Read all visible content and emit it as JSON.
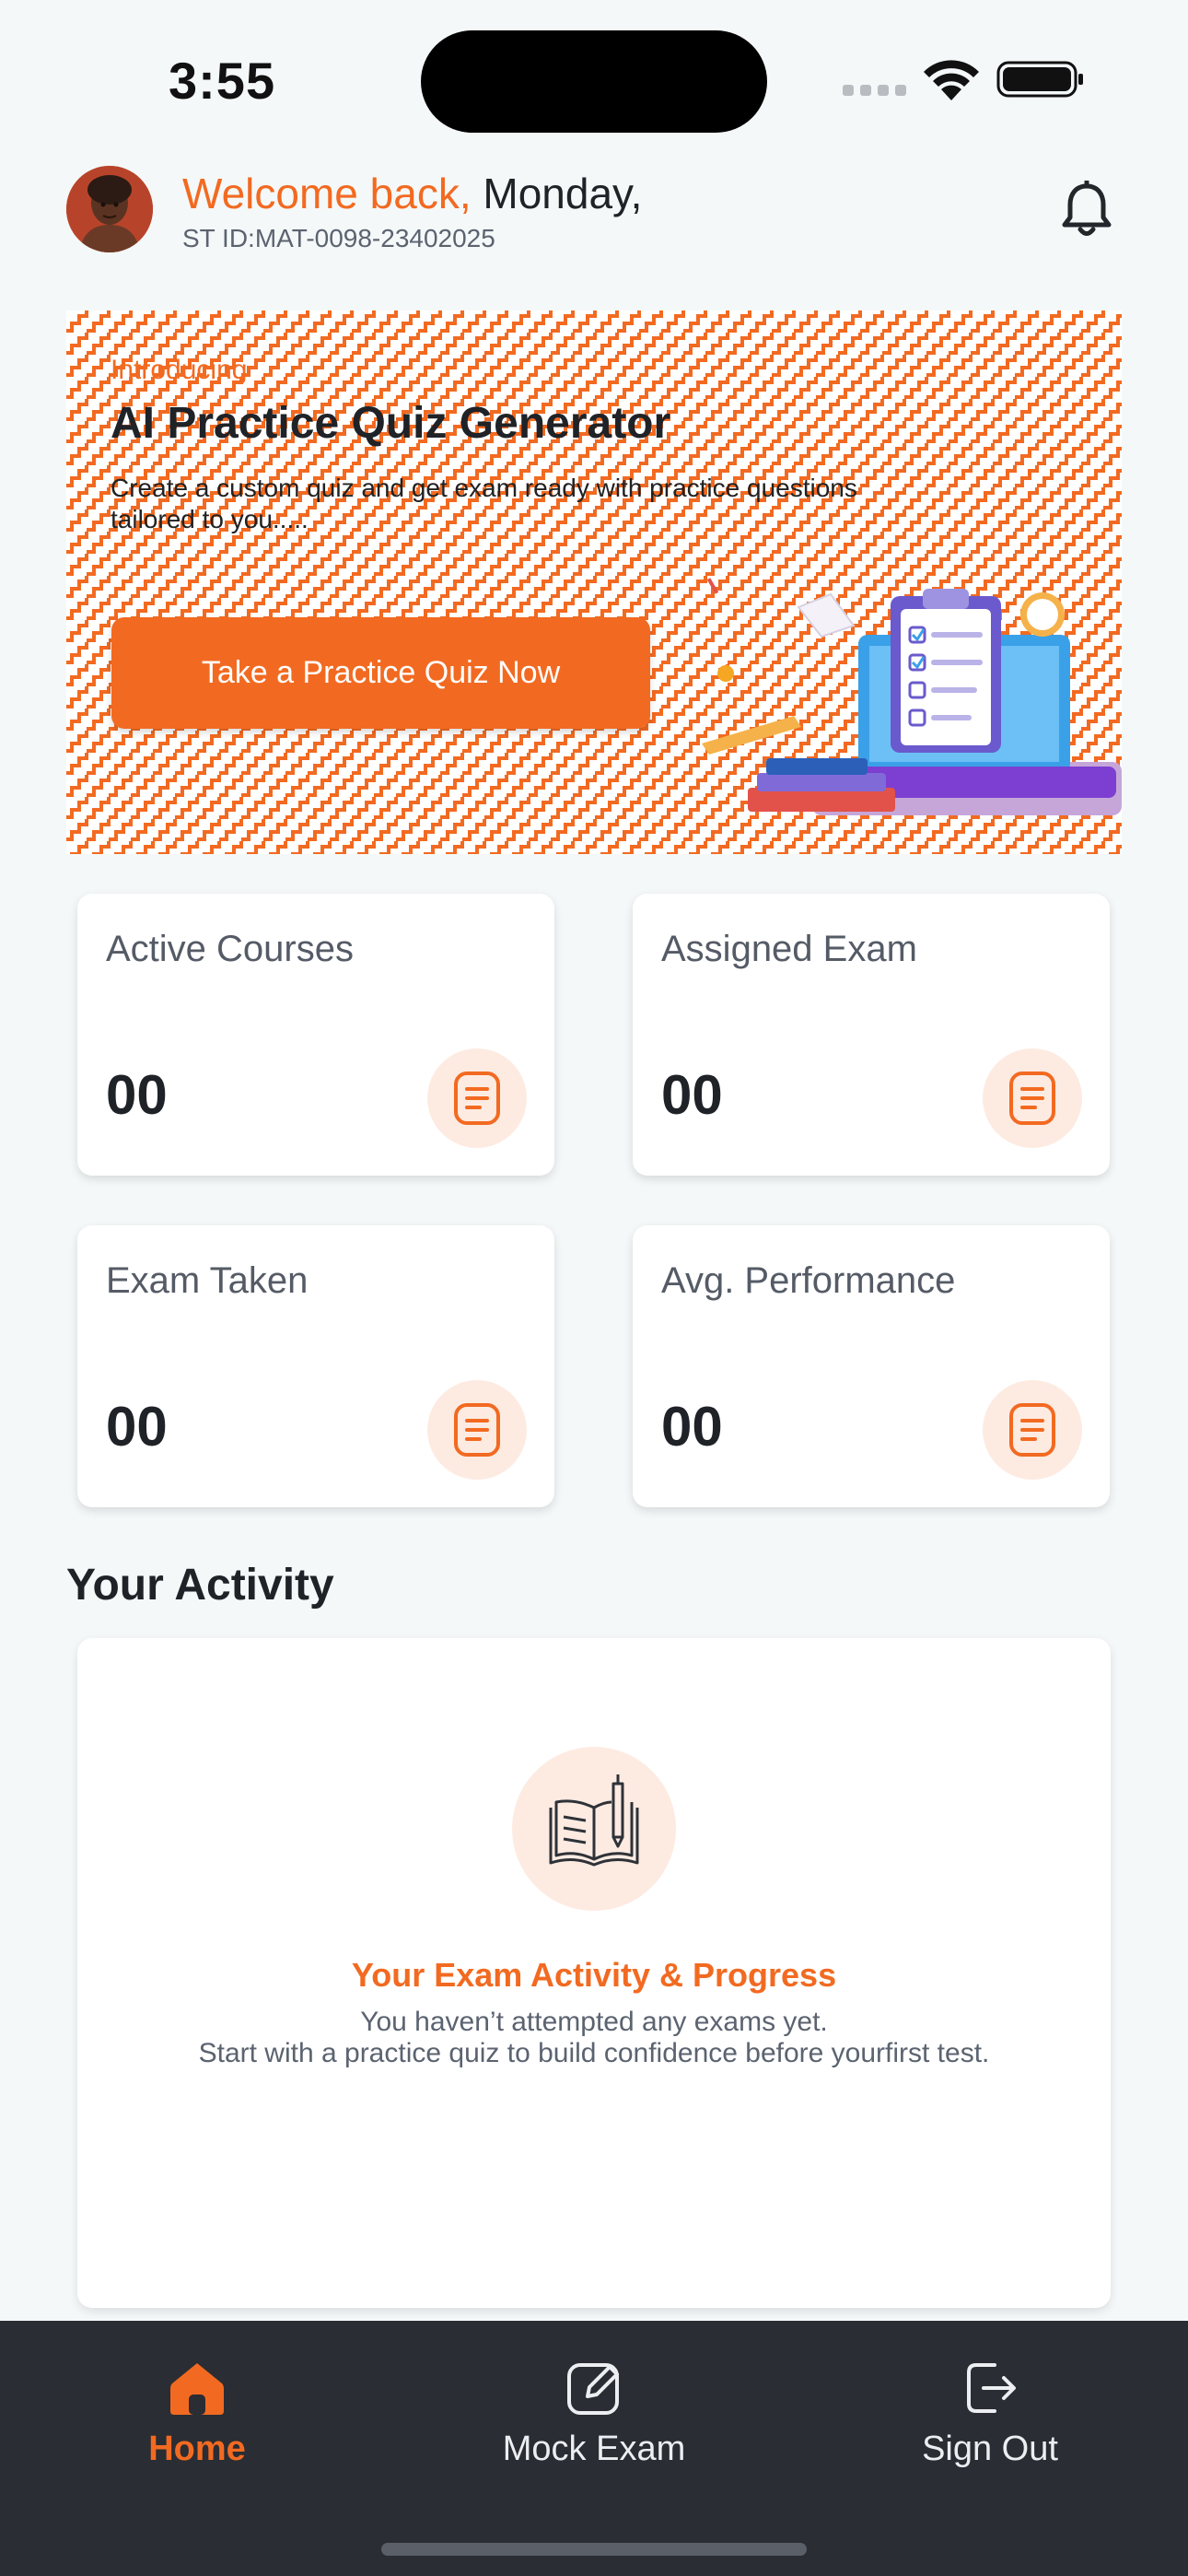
{
  "status_bar": {
    "time": "3:55"
  },
  "header": {
    "greeting": "Welcome back,",
    "day": "Monday,",
    "student_id": "ST ID:MAT-0098-23402025",
    "avatar_icon": "user-avatar",
    "notification_icon": "bell-icon"
  },
  "banner": {
    "intro": "Introducing",
    "title": "AI Practice Quiz Generator",
    "description": "Create a custom quiz and get exam ready with practice questions tailored to you.....",
    "cta_label": "Take a Practice Quiz Now",
    "accent_color": "#f26a21"
  },
  "stats": [
    {
      "title": "Active Courses",
      "value": "00",
      "icon": "document-icon"
    },
    {
      "title": "Assigned Exam",
      "value": "00",
      "icon": "document-icon"
    },
    {
      "title": "Exam Taken",
      "value": "00",
      "icon": "document-icon"
    },
    {
      "title": "Avg. Performance",
      "value": "00",
      "icon": "document-icon"
    }
  ],
  "activity": {
    "section_title": "Your Activity",
    "empty_title": "Your Exam Activity & Progress",
    "empty_line1": "You haven’t attempted any exams yet.",
    "empty_line2": "Start with a practice quiz to build confidence before yourfirst test.",
    "icon": "open-book-pen-icon"
  },
  "bottom_nav": {
    "items": [
      {
        "label": "Home",
        "icon": "home-icon",
        "active": true
      },
      {
        "label": "Mock Exam",
        "icon": "edit-icon",
        "active": false
      },
      {
        "label": "Sign Out",
        "icon": "sign-out-icon",
        "active": false
      }
    ]
  },
  "colors": {
    "accent": "#f26a21",
    "nav_background": "#2a2d33",
    "page_background": "#f4f8f8"
  }
}
